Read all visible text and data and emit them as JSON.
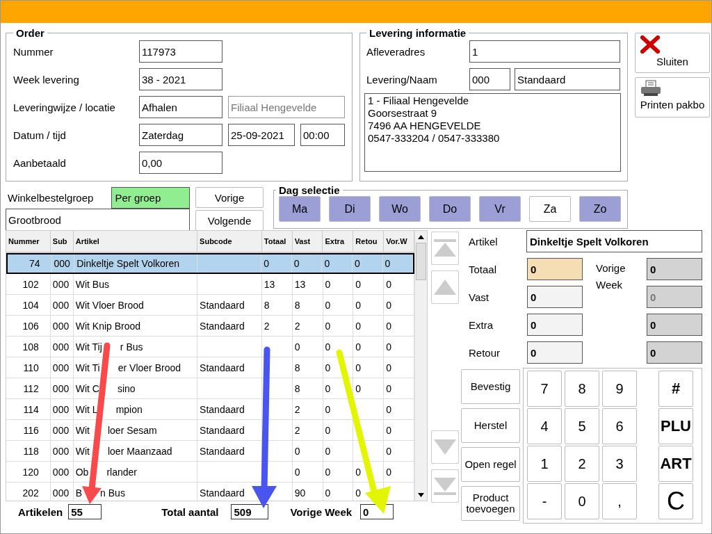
{
  "order": {
    "title": "Order",
    "rows": [
      {
        "label": "Nummer",
        "fields": [
          {
            "value": "117973",
            "disabled": false
          }
        ]
      },
      {
        "label": "Week levering",
        "fields": [
          {
            "value": "38 - 2021",
            "disabled": false
          }
        ]
      },
      {
        "label": "Leveringwijze / locatie",
        "fields": [
          {
            "value": "Afhalen",
            "disabled": false
          },
          {
            "value": "Filiaal Hengevelde",
            "disabled": true
          }
        ]
      },
      {
        "label": "Datum / tijd",
        "fields": [
          {
            "value": "Zaterdag",
            "disabled": false
          },
          {
            "value": "25-09-2021",
            "disabled": false
          },
          {
            "value": "00:00",
            "disabled": false
          }
        ]
      },
      {
        "label": "Aanbetaald",
        "fields": [
          {
            "value": "0,00",
            "disabled": false
          }
        ]
      }
    ]
  },
  "delivery": {
    "title": "Levering informatie",
    "address_label": "Afleveradres",
    "address": "1",
    "name_label": "Levering/Naam",
    "name_code": "000",
    "name": "Standaard",
    "address_lines": [
      "1 - Filiaal Hengevelde",
      "Goorsestraat 9",
      "7496 AA HENGEVELDE",
      "0547-333204 / 0547-333380"
    ]
  },
  "side_buttons": [
    {
      "kind": "close",
      "label": "Sluiten"
    },
    {
      "kind": "print",
      "label": "Printen pakbo"
    }
  ],
  "group": {
    "label": "Winkelbestelgroep",
    "mode": "Per groep",
    "value": "Grootbrood",
    "previous": "Vorige",
    "next": "Volgende"
  },
  "day_selection": {
    "title": "Dag selectie",
    "days": [
      {
        "label": "Ma",
        "selected": true
      },
      {
        "label": "Di",
        "selected": true
      },
      {
        "label": "Wo",
        "selected": true
      },
      {
        "label": "Do",
        "selected": true
      },
      {
        "label": "Vr",
        "selected": true
      },
      {
        "label": "Za",
        "selected": false
      },
      {
        "label": "Zo",
        "selected": true
      }
    ]
  },
  "table": {
    "columns": [
      "Nummer",
      "Sub",
      "Artikel",
      "Subcode",
      "Totaal",
      "Vast",
      "Extra",
      "Retou",
      "Vor.W"
    ],
    "rows": [
      {
        "selected": true,
        "nummer": "74",
        "sub": "000",
        "artikel": [
          "Dinkeltje Spelt Volkoren"
        ],
        "totaal": "0",
        "vast": "0",
        "extra": "0",
        "retour": "0",
        "vor_w": "0"
      },
      {
        "selected": false,
        "nummer": "102",
        "sub": "000",
        "artikel": [
          "Wit Bus"
        ],
        "totaal": "13",
        "vast": "13",
        "extra": "0",
        "retour": "0",
        "vor_w": "0"
      },
      {
        "selected": false,
        "nummer": "104",
        "sub": "000",
        "artikel": [
          "Wit Vloer Brood"
        ],
        "subcode": "Standaard",
        "totaal": "8",
        "vast": "8",
        "extra": "0",
        "retour": "0",
        "vor_w": "0"
      },
      {
        "selected": false,
        "nummer": "106",
        "sub": "000",
        "artikel": [
          "Wit Knip Brood"
        ],
        "subcode": "Standaard",
        "totaal": "2",
        "vast": "2",
        "extra": "0",
        "retour": "0",
        "vor_w": "0"
      },
      {
        "selected": false,
        "nummer": "108",
        "sub": "000",
        "artikel": [
          "Wit Tij",
          "r Bus"
        ],
        "vast": "0",
        "extra": "0",
        "retour": "0",
        "vor_w": "0"
      },
      {
        "selected": false,
        "nummer": "110",
        "sub": "000",
        "artikel": [
          "Wit Ti",
          "er Vloer Brood"
        ],
        "subcode": "Standaard",
        "vast": "8",
        "extra": "0",
        "retour": "0",
        "vor_w": "0"
      },
      {
        "selected": false,
        "nummer": "112",
        "sub": "000",
        "artikel": [
          "Wit C",
          "sino"
        ],
        "vast": "8",
        "extra": "0",
        "retour": "0",
        "vor_w": "0"
      },
      {
        "selected": false,
        "nummer": "114",
        "sub": "000",
        "artikel": [
          "Wit L",
          "mpion"
        ],
        "subcode": "Standaard",
        "vast": "2",
        "extra": "0",
        "vor_w": "0"
      },
      {
        "selected": false,
        "nummer": "116",
        "sub": "000",
        "artikel": [
          "Wit",
          "loer Sesam"
        ],
        "subcode": "Standaard",
        "vast": "2",
        "extra": "0",
        "vor_w": "0"
      },
      {
        "selected": false,
        "nummer": "118",
        "sub": "000",
        "artikel": [
          "Wit",
          "loer Maanzaad"
        ],
        "subcode": "Standaard",
        "vast": "0",
        "extra": "0",
        "vor_w": "0"
      },
      {
        "selected": false,
        "nummer": "120",
        "sub": "000",
        "artikel": [
          "Ob",
          "rlander"
        ],
        "vast": "0",
        "extra": "0",
        "retour": "0",
        "vor_w": "0"
      },
      {
        "selected": false,
        "nummer": "202",
        "sub": "000",
        "artikel": [
          "B",
          "n Bus"
        ],
        "subcode": "Standaard",
        "vast": "90",
        "extra": "0",
        "retour": "0"
      }
    ]
  },
  "totals": [
    {
      "label": "Artikelen",
      "value": "55"
    },
    {
      "label": "Total aantal",
      "value": "509"
    },
    {
      "label": "Vorige Week",
      "value": "0"
    }
  ],
  "detail": {
    "article_label": "Artikel",
    "article": "Dinkeltje Spelt Volkoren",
    "previous_label": "Vorige Week",
    "rows": [
      {
        "label": "Totaal",
        "value": "0",
        "focused": true,
        "previous": "0",
        "previous_disabled": false
      },
      {
        "label": "Vast",
        "value": "0",
        "focused": false,
        "previous": "0",
        "previous_disabled": true
      },
      {
        "label": "Extra",
        "value": "0",
        "focused": false,
        "previous": "0",
        "previous_disabled": false
      },
      {
        "label": "Retour",
        "value": "0",
        "focused": false,
        "previous": "0",
        "previous_disabled": false
      }
    ]
  },
  "actions": [
    "Bevestig",
    "Herstel",
    "Open regel",
    "Product toevoegen"
  ],
  "keypad": [
    [
      {
        "label": "7",
        "kind": "digit"
      },
      {
        "label": "8",
        "kind": "digit"
      },
      {
        "label": "9",
        "kind": "digit"
      },
      {
        "label": "#",
        "kind": "function"
      }
    ],
    [
      {
        "label": "4",
        "kind": "digit"
      },
      {
        "label": "5",
        "kind": "digit"
      },
      {
        "label": "6",
        "kind": "digit"
      },
      {
        "label": "PLU",
        "kind": "function"
      }
    ],
    [
      {
        "label": "1",
        "kind": "digit"
      },
      {
        "label": "2",
        "kind": "digit"
      },
      {
        "label": "3",
        "kind": "digit"
      },
      {
        "label": "ART",
        "kind": "function"
      }
    ],
    [
      {
        "label": "-",
        "kind": "digit"
      },
      {
        "label": "0",
        "kind": "digit"
      },
      {
        "label": ",",
        "kind": "digit"
      },
      {
        "label": "C",
        "kind": "clear"
      }
    ]
  ]
}
